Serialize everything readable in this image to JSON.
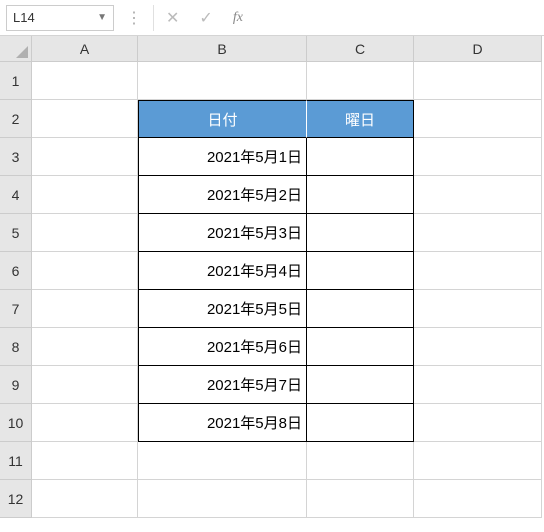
{
  "nameBox": {
    "value": "L14"
  },
  "formulaBar": {
    "cancelIcon": "✕",
    "confirmIcon": "✓",
    "fxLabel": "fx",
    "value": ""
  },
  "columns": [
    "A",
    "B",
    "C",
    "D"
  ],
  "rows": [
    "1",
    "2",
    "3",
    "4",
    "5",
    "6",
    "7",
    "8",
    "9",
    "10",
    "11",
    "12"
  ],
  "tableHeaders": {
    "date": "日付",
    "weekday": "曜日"
  },
  "tableData": [
    {
      "date": "2021年5月1日",
      "weekday": ""
    },
    {
      "date": "2021年5月2日",
      "weekday": ""
    },
    {
      "date": "2021年5月3日",
      "weekday": ""
    },
    {
      "date": "2021年5月4日",
      "weekday": ""
    },
    {
      "date": "2021年5月5日",
      "weekday": ""
    },
    {
      "date": "2021年5月6日",
      "weekday": ""
    },
    {
      "date": "2021年5月7日",
      "weekday": ""
    },
    {
      "date": "2021年5月8日",
      "weekday": ""
    }
  ]
}
